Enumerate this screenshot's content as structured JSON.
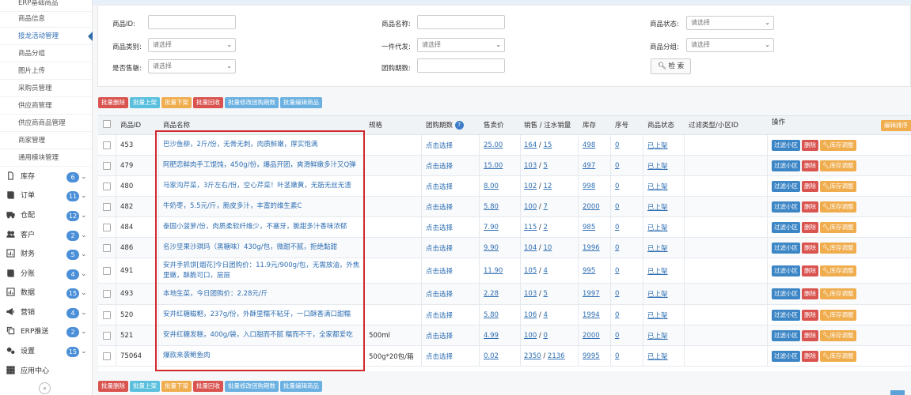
{
  "sidebar": {
    "sub_items": [
      {
        "label": "ERP基础商品",
        "active": false
      },
      {
        "label": "商品信息",
        "active": false
      },
      {
        "label": "接龙活动管理",
        "active": true
      },
      {
        "label": "商品分组",
        "active": false
      },
      {
        "label": "图片上传",
        "active": false
      },
      {
        "label": "采购员管理",
        "active": false
      },
      {
        "label": "供应商管理",
        "active": false
      },
      {
        "label": "供应商商品管理",
        "active": false
      },
      {
        "label": "商家管理",
        "active": false
      },
      {
        "label": "通用模块管理",
        "active": false
      }
    ],
    "main_items": [
      {
        "label": "库存",
        "icon": "file-icon",
        "badge": "6"
      },
      {
        "label": "订单",
        "icon": "book-icon",
        "badge": "11"
      },
      {
        "label": "仓配",
        "icon": "truck-icon",
        "badge": "12"
      },
      {
        "label": "客户",
        "icon": "users-icon",
        "badge": "2"
      },
      {
        "label": "财务",
        "icon": "chart-icon",
        "badge": "5"
      },
      {
        "label": "分账",
        "icon": "book-icon",
        "badge": "4"
      },
      {
        "label": "数据",
        "icon": "chart-icon",
        "badge": "15"
      },
      {
        "label": "营销",
        "icon": "megaphone-icon",
        "badge": "4"
      },
      {
        "label": "ERP推送",
        "icon": "copy-icon",
        "badge": "2"
      },
      {
        "label": "设置",
        "icon": "gear-icon",
        "badge": "15"
      },
      {
        "label": "应用中心",
        "icon": "grid-icon",
        "badge": ""
      }
    ],
    "collapse_glyph": "«"
  },
  "filters": {
    "product_id_label": "商品ID:",
    "product_name_label": "商品名称:",
    "product_status_label": "商品状态:",
    "product_category_label": "商品类别:",
    "dropship_label": "一件代发:",
    "product_group_label": "商品分组:",
    "presale_label": "是否售罄:",
    "group_period_label": "团购期数:",
    "select_placeholder": "请选择",
    "search_label": "检 索"
  },
  "actions": [
    "批量删除",
    "批量上架",
    "批量下架",
    "批量回收",
    "批量修改团购期数",
    "批量编辑商品"
  ],
  "table": {
    "headers": {
      "id": "商品ID",
      "name": "商品名称",
      "spec": "规格",
      "period": "团购期数",
      "price": "售卖价",
      "sales": "销售 / 注水销量",
      "stock": "库存",
      "seq": "序号",
      "status": "商品状态",
      "filter": "过滤类型/小区ID",
      "ops": "操作",
      "edit_all": "编辑排序"
    },
    "period_link": "点击选择",
    "op_filter": "过滤小区",
    "op_delete": "删除",
    "op_stock": "库存调整",
    "rows": [
      {
        "id": "453",
        "name": "巴沙鱼柳，2斤/份，无骨无刺，肉质鲜嫩，厚实饱满",
        "spec": "",
        "price": "25.00",
        "sales": "164",
        "fake_sales": "15",
        "stock": "498",
        "seq": "0",
        "status": "已上架"
      },
      {
        "id": "479",
        "name": "阿肥恋鲜肉手工馄饨，450g/份，爆品开团，爽滑鲜嫩多汁又Q弹",
        "spec": "",
        "price": "15.00",
        "sales": "103",
        "fake_sales": "5",
        "stock": "497",
        "seq": "0",
        "status": "已上架"
      },
      {
        "id": "480",
        "name": "马家沟芹菜，3斤左右/份，空心芹菜！叶茎嫩黄，无筋无丝无渣",
        "spec": "",
        "price": "8.00",
        "sales": "102",
        "fake_sales": "12",
        "stock": "998",
        "seq": "0",
        "status": "已上架"
      },
      {
        "id": "482",
        "name": "牛奶枣，5.5元/斤，脆皮多汁，丰富的维生素C",
        "spec": "",
        "price": "5.80",
        "sales": "100",
        "fake_sales": "7",
        "stock": "2000",
        "seq": "0",
        "status": "已上架"
      },
      {
        "id": "484",
        "name": "泰国小菠萝/份，肉质柔软纤维少，不塞牙，脆甜多汁香味浓郁",
        "spec": "",
        "price": "7.90",
        "sales": "115",
        "fake_sales": "2",
        "stock": "985",
        "seq": "0",
        "status": "已上架"
      },
      {
        "id": "486",
        "name": "名沙坚果沙琪玛（黑糖味）430g/包，微甜不腻，拒绝黏甜",
        "spec": "",
        "price": "9.90",
        "sales": "104",
        "fake_sales": "10",
        "stock": "1996",
        "seq": "0",
        "status": "已上架"
      },
      {
        "id": "491",
        "name": "安井手抓饼[烟花]今日团购价：11.9元/900g/包，无需放油，外焦里嫩，酥脆可口，层层",
        "spec": "",
        "price": "11.90",
        "sales": "105",
        "fake_sales": "4",
        "stock": "995",
        "seq": "0",
        "status": "已上架"
      },
      {
        "id": "493",
        "name": "本地生菜，今日团购价：2.28元/斤",
        "spec": "",
        "price": "2.28",
        "sales": "103",
        "fake_sales": "5",
        "stock": "1997",
        "seq": "0",
        "status": "已上架"
      },
      {
        "id": "520",
        "name": "安井红糖糍粑，237g/份，外酥里糯不粘牙，一口酥香满口甜糯",
        "spec": "",
        "price": "5.80",
        "sales": "106",
        "fake_sales": "4",
        "stock": "1994",
        "seq": "0",
        "status": "已上架"
      },
      {
        "id": "521",
        "name": "安井红糖发糕，400g/袋，入口甜而不腻 糯而不干，全家都爱吃",
        "spec": "500ml",
        "price": "4.99",
        "sales": "100",
        "fake_sales": "0",
        "stock": "2000",
        "seq": "0",
        "status": "已上架"
      },
      {
        "id": "75064",
        "name": "爆款来袭鲍鱼肉",
        "spec": "500g*20包/箱",
        "price": "0.02",
        "sales": "2350",
        "fake_sales": "2136",
        "stock": "9995",
        "seq": "0",
        "status": "已上架"
      }
    ]
  },
  "colors": {
    "accent": "#2f6fb3",
    "danger": "#d9534f",
    "info": "#5bc0de",
    "warning": "#f0ad4e",
    "highlight": "#d0282c"
  }
}
